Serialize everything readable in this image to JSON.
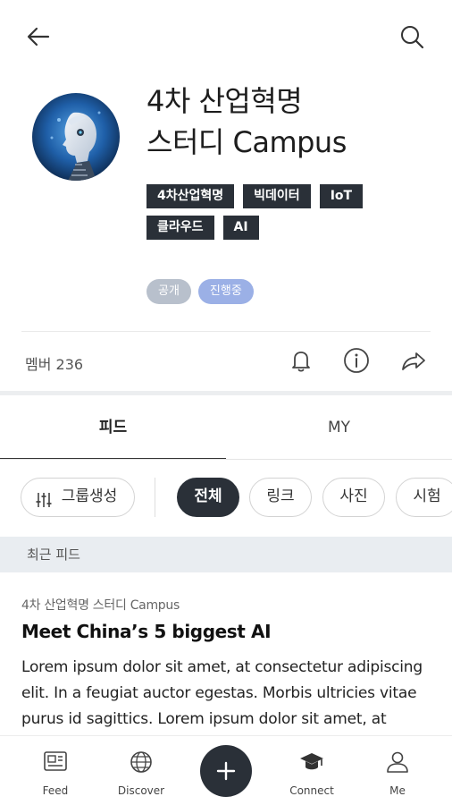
{
  "header": {
    "back_icon": "arrow-left-icon",
    "search_icon": "search-icon"
  },
  "profile": {
    "title_line1": "4차 산업혁명",
    "title_line2": "스터디 Campus",
    "tags": [
      "4차산업혁명",
      "빅데이터",
      "IoT",
      "클라우드",
      "AI"
    ],
    "status": {
      "public": "공개",
      "progress": "진행중"
    }
  },
  "members": {
    "label": "멤버 236"
  },
  "actions": [
    "bell-icon",
    "info-icon",
    "share-icon"
  ],
  "tabs": {
    "feed": "피드",
    "my": "MY"
  },
  "chips": {
    "create_group": "그룹생성",
    "all": "전체",
    "link": "링크",
    "photo": "사진",
    "exam": "시험"
  },
  "section": {
    "title": "최근 피드"
  },
  "post": {
    "group": "4차 산업혁명 스터디 Campus",
    "title": "Meet China’s 5 biggest AI",
    "body": "Lorem ipsum dolor sit amet, at consectetur adipiscing elit. In a feugiat auctor egestas. Morbis ultricies vitae purus id sagittics. Lorem ipsum dolor sit amet, at"
  },
  "bottom_nav": {
    "feed": "Feed",
    "discover": "Discover",
    "add_icon": "plus-icon",
    "connect": "Connect",
    "me": "Me"
  },
  "colors": {
    "dark": "#2a3038",
    "pill_public": "#b8c0cc",
    "pill_progress": "#9bb0e6",
    "section_bg": "#e9edf1"
  }
}
